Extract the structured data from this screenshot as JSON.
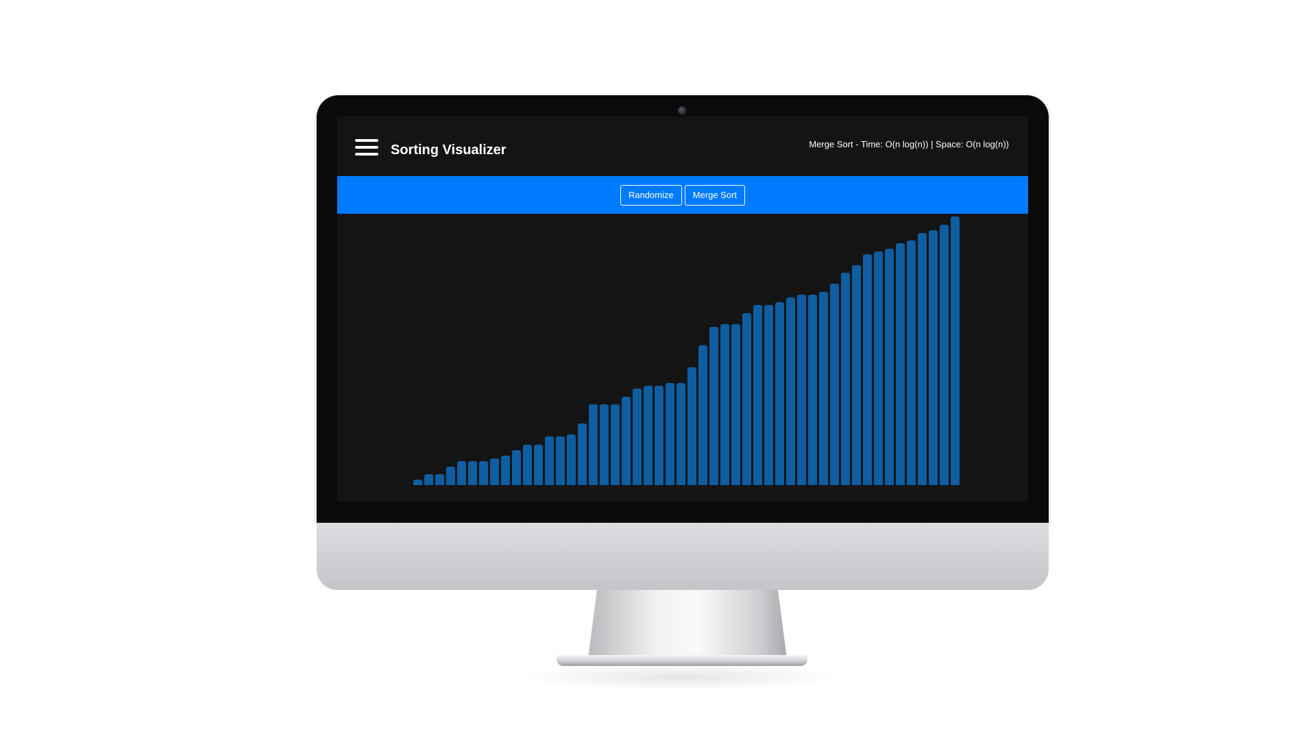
{
  "app": {
    "title": "Sorting Visualizer",
    "algorithm_info": "Merge Sort - Time: O(n log(n)) | Space: O(n log(n))",
    "menu_icon": "hamburger-menu-icon"
  },
  "toolbar": {
    "randomize_label": "Randomize",
    "sort_label": "Merge Sort"
  },
  "colors": {
    "accent": "#007bff",
    "background": "#141414",
    "bar": "#0e5ea1",
    "text": "#ffffff"
  },
  "chart_data": {
    "type": "bar",
    "title": "",
    "values": [
      2,
      4,
      4,
      7,
      9,
      9,
      9,
      10,
      11,
      13,
      15,
      15,
      18,
      18,
      19,
      23,
      30,
      30,
      30,
      33,
      36,
      37,
      37,
      38,
      38,
      44,
      52,
      59,
      60,
      60,
      64,
      67,
      67,
      68,
      70,
      71,
      71,
      72,
      75,
      79,
      82,
      86,
      87,
      88,
      90,
      91,
      94,
      95,
      97,
      100
    ],
    "ylim": [
      0,
      100
    ]
  }
}
